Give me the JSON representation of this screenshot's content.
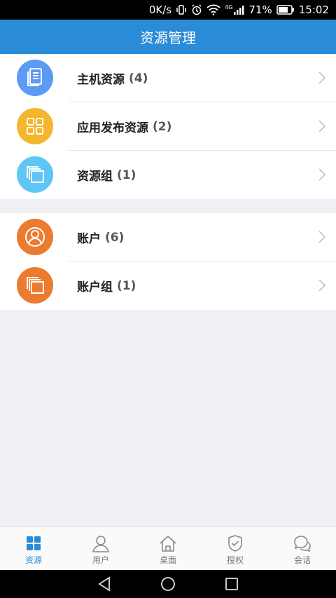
{
  "status_bar": {
    "speed": "0K/s",
    "network": "4G",
    "battery": "71%",
    "time": "15:02"
  },
  "header": {
    "title": "资源管理"
  },
  "groups": [
    {
      "items": [
        {
          "label": "主机资源",
          "count": "(4)",
          "icon": "document-icon",
          "color": "#5b9af5"
        },
        {
          "label": "应用发布资源",
          "count": "(2)",
          "icon": "grid-icon",
          "color": "#f3b72d"
        },
        {
          "label": "资源组",
          "count": "(1)",
          "icon": "stacked-windows-icon",
          "color": "#5ec6f5"
        }
      ]
    },
    {
      "items": [
        {
          "label": "账户",
          "count": "(6)",
          "icon": "user-icon",
          "color": "#ec7a2f"
        },
        {
          "label": "账户组",
          "count": "(1)",
          "icon": "stacked-windows-icon",
          "color": "#ec7a2f"
        }
      ]
    }
  ],
  "bottom_nav": {
    "items": [
      {
        "label": "资源",
        "icon": "grid-icon",
        "active": true
      },
      {
        "label": "用户",
        "icon": "user-icon",
        "active": false
      },
      {
        "label": "桌面",
        "icon": "home-icon",
        "active": false
      },
      {
        "label": "授权",
        "icon": "shield-check-icon",
        "active": false
      },
      {
        "label": "会话",
        "icon": "chat-icon",
        "active": false
      }
    ]
  },
  "colors": {
    "header": "#2a8bd6",
    "active": "#2a8bd6",
    "background": "#eef0f4"
  }
}
